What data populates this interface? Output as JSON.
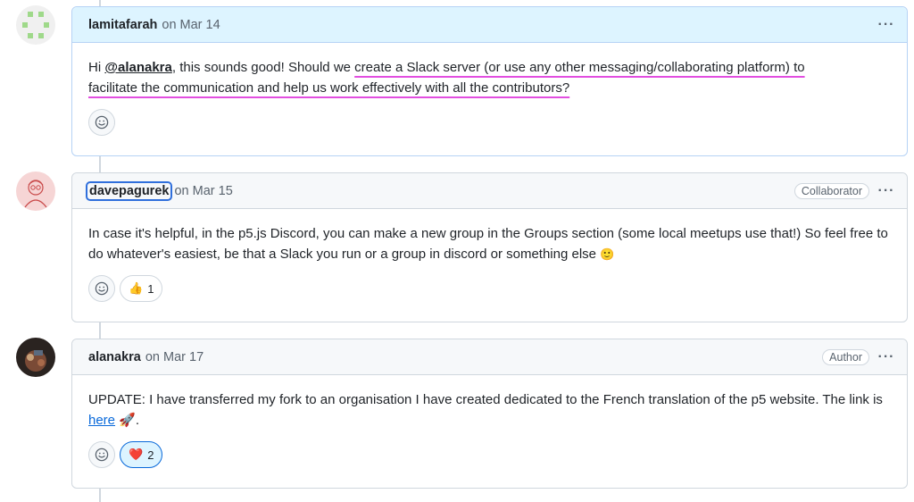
{
  "comments": [
    {
      "author": "lamitafarah",
      "date": "on Mar 14",
      "badge": "",
      "body": {
        "p1": "Hi ",
        "mention": "@alanakra",
        "p2": ", this sounds good! Should we ",
        "highlight_line1": "create a Slack server (or use any other messaging/collaborating platform) to",
        "highlight_line2": "facilitate the communication and help us work effectively with all the contributors?"
      },
      "reactions": []
    },
    {
      "author": "davepagurek",
      "date": "on Mar 15",
      "badge": "Collaborator",
      "body": {
        "text": "In case it's helpful, in the p5.js Discord, you can make a new group in the Groups section (some local meetups use that!) So feel free to do whatever's easiest, be that a Slack you run or a group in discord or something else",
        "emoji": "🙂"
      },
      "reactions": [
        {
          "emoji": "👍",
          "count": "1"
        }
      ]
    },
    {
      "author": "alanakra",
      "date": "on Mar 17",
      "badge": "Author",
      "body": {
        "text": "UPDATE: I have transferred my fork to an organisation I have created dedicated to the French translation of the p5 website. The link is ",
        "link": "here",
        "after": " 🚀."
      },
      "reactions": [
        {
          "emoji": "❤️",
          "count": "2"
        }
      ]
    }
  ],
  "icons": {
    "menu": "kebab-horizontal-icon",
    "add_reaction": "smiley-icon"
  },
  "colors": {
    "link": "#0969da",
    "highlight_underline": "#e24ee0",
    "focus_outline": "#2f6fdc"
  }
}
